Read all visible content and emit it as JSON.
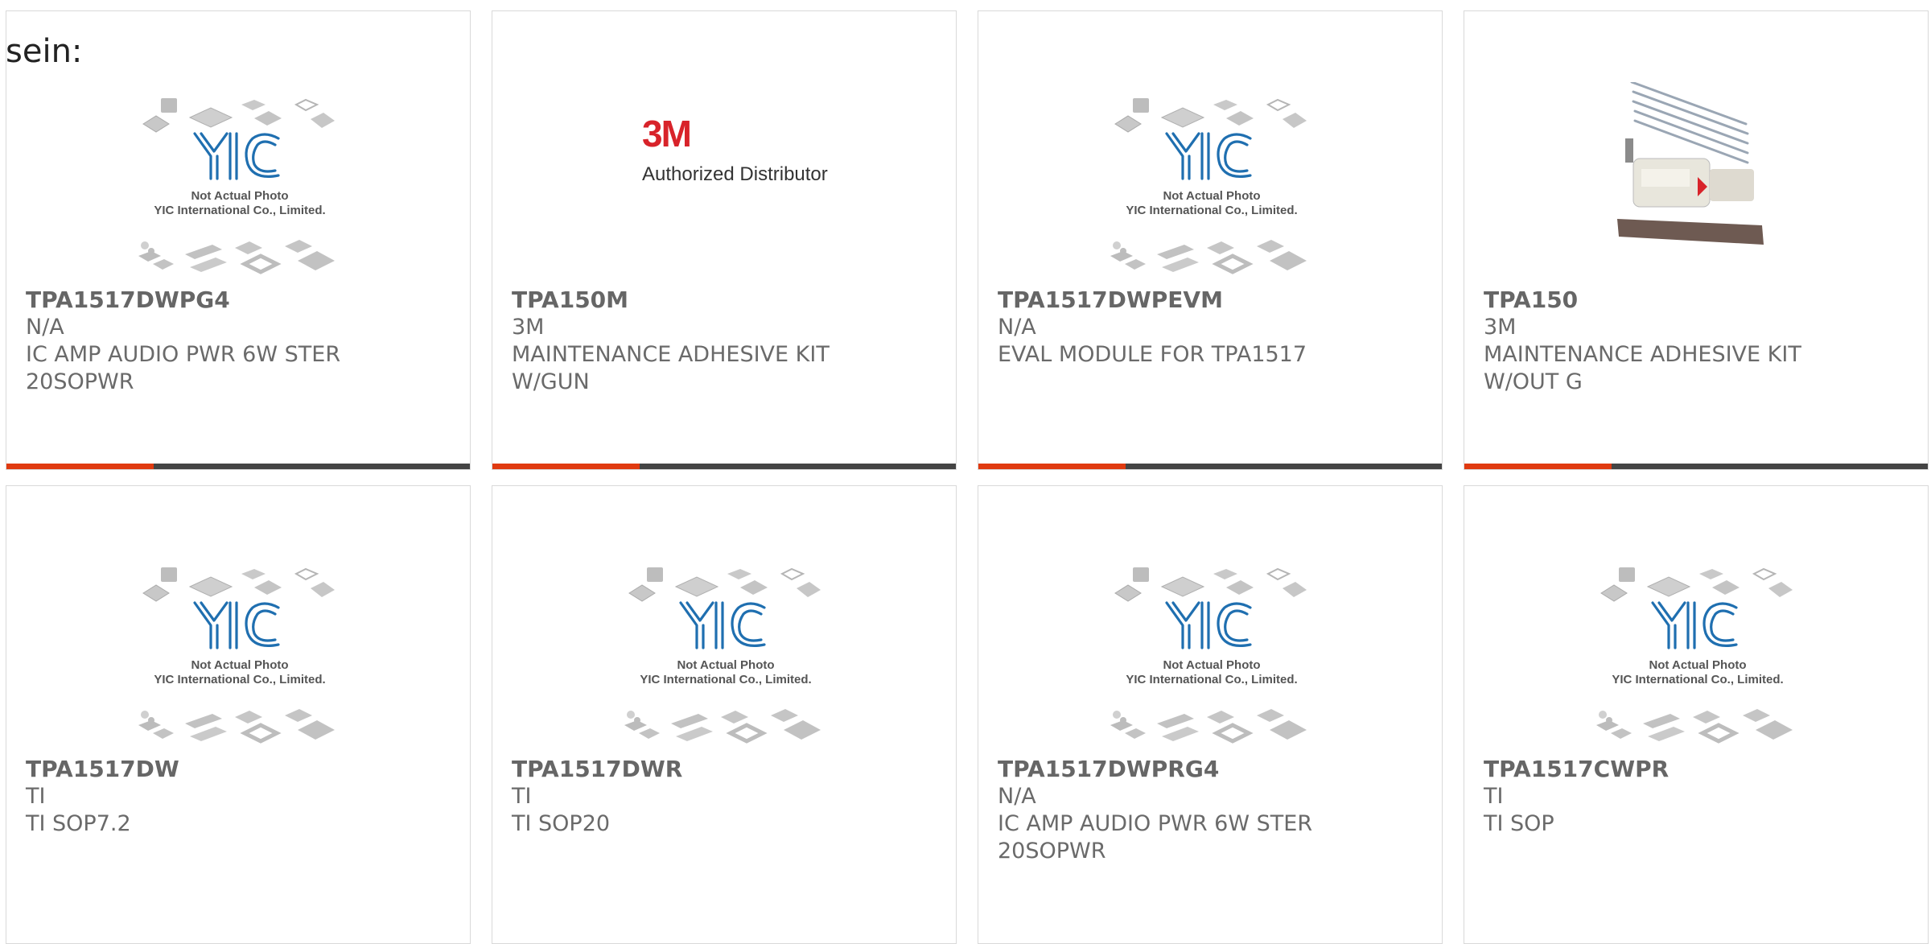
{
  "page": {
    "partial_text": "sein:"
  },
  "placeholder": {
    "caption_line1": "Not Actual Photo",
    "caption_line2": "YIC International Co., Limited."
  },
  "brand_3m": {
    "logo_text": "3M",
    "subtitle": "Authorized Distributor"
  },
  "colors": {
    "accent": "#e03a10",
    "bar": "#444444",
    "yic_blue": "#1f6fb0",
    "text": "#666666",
    "border": "#d9d9d9"
  },
  "products": [
    {
      "part_number": "TPA1517DWPG4",
      "manufacturer": "N/A",
      "description": "IC AMP AUDIO PWR 6W STER 20SOPWR",
      "image": "yic-placeholder"
    },
    {
      "part_number": "TPA150M",
      "manufacturer": "3M",
      "description": "MAINTENANCE ADHESIVE KIT W/GUN",
      "image": "3m-logo"
    },
    {
      "part_number": "TPA1517DWPEVM",
      "manufacturer": "N/A",
      "description": "EVAL MODULE FOR TPA1517",
      "image": "yic-placeholder"
    },
    {
      "part_number": "TPA150",
      "manufacturer": "3M",
      "description": "MAINTENANCE ADHESIVE KIT W/OUT G",
      "image": "adhesive-kit-photo"
    },
    {
      "part_number": "TPA1517DW",
      "manufacturer": "TI",
      "description": "TI SOP7.2",
      "image": "yic-placeholder"
    },
    {
      "part_number": "TPA1517DWR",
      "manufacturer": "TI",
      "description": "TI SOP20",
      "image": "yic-placeholder"
    },
    {
      "part_number": "TPA1517DWPRG4",
      "manufacturer": "N/A",
      "description": "IC AMP AUDIO PWR 6W STER 20SOPWR",
      "image": "yic-placeholder"
    },
    {
      "part_number": "TPA1517CWPR",
      "manufacturer": "TI",
      "description": "TI SOP",
      "image": "yic-placeholder"
    }
  ]
}
